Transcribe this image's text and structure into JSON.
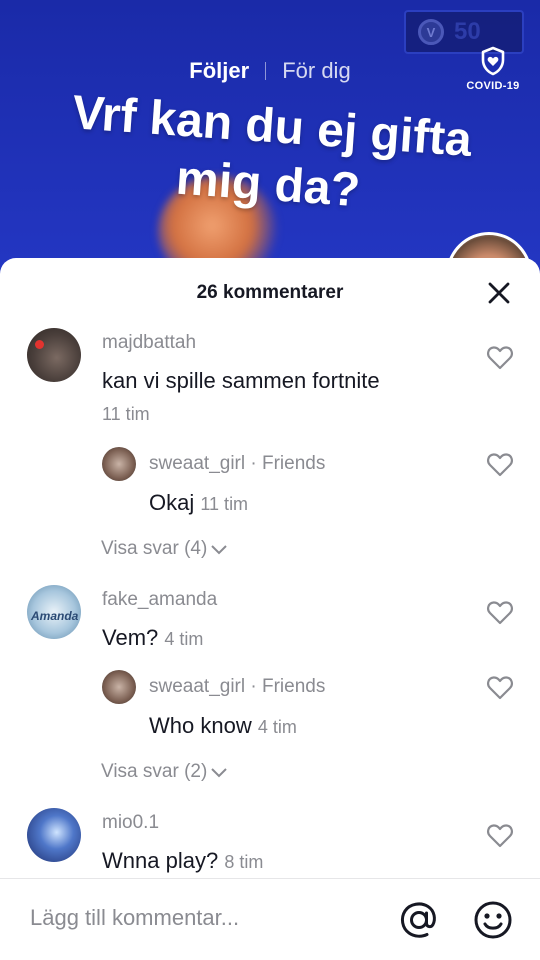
{
  "video": {
    "coin_count": "50",
    "nav": {
      "following": "Följer",
      "for_you": "För dig"
    },
    "covid_label": "COVID-19",
    "caption_line1": "Vrf kan du ej gifta",
    "caption_line2": "mig da?"
  },
  "comments_sheet": {
    "title": "26 kommentarer",
    "comments": [
      {
        "username": "majdbattah",
        "text": "kan vi spille sammen fortnite",
        "time": "11 tim",
        "reply": {
          "username": "sweaat_girl",
          "tag": " · Friends",
          "text": "Okaj",
          "time": "11 tim"
        },
        "view_replies": "Visa svar (4)"
      },
      {
        "username": "fake_amanda",
        "text": "Vem?",
        "time": "4 tim",
        "reply": {
          "username": "sweaat_girl",
          "tag": " · Friends",
          "text": "Who know",
          "time": "4 tim"
        },
        "view_replies": "Visa svar (2)"
      },
      {
        "username": "mio0.1",
        "text": "Wnna play?",
        "time": "8 tim"
      }
    ],
    "composer_placeholder": "Lägg till kommentar..."
  },
  "colors": {
    "sheet_bg": "#ffffff",
    "text_primary": "#161823",
    "text_secondary": "#8a8b91",
    "video_bg": "#2437c4"
  }
}
